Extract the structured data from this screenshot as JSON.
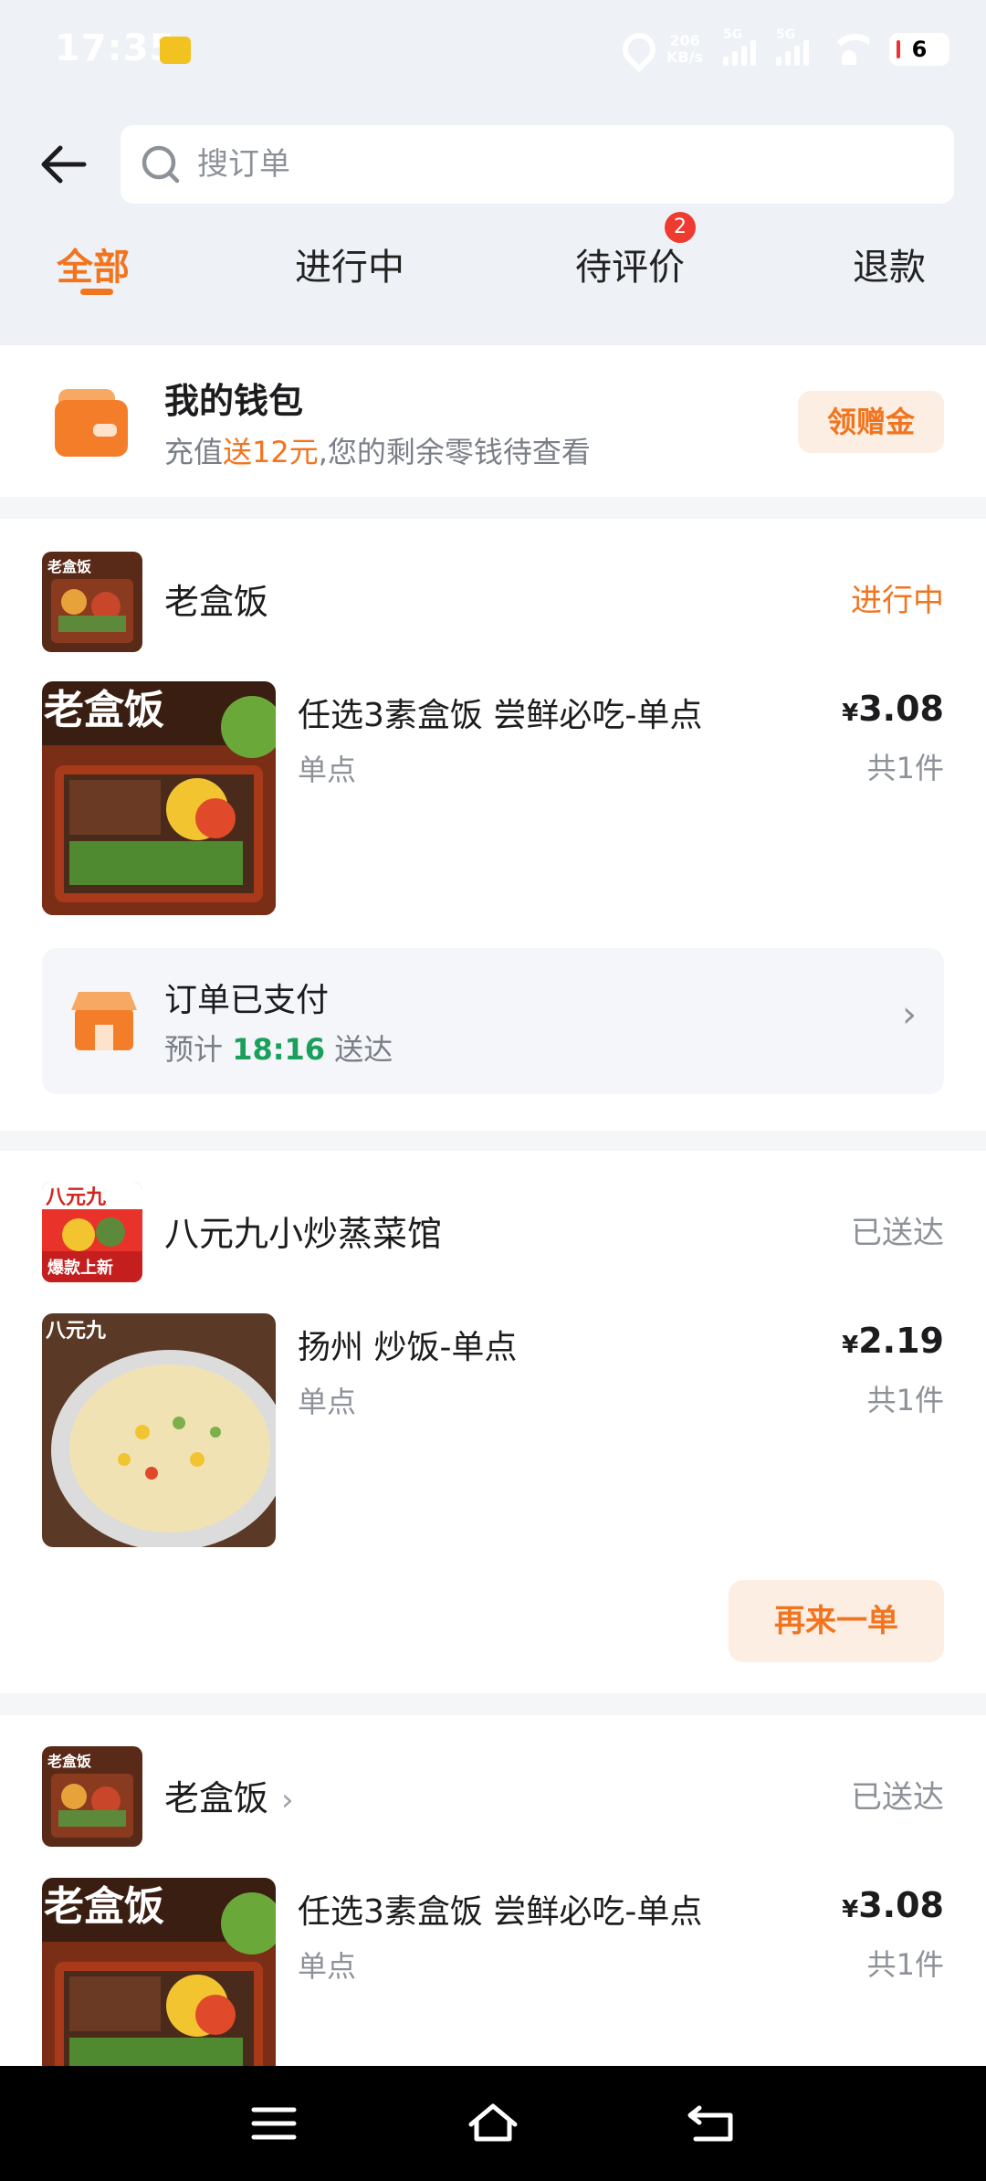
{
  "status_bar": {
    "time": "17:35",
    "speed": "206\nKB/s",
    "signal1": "5G",
    "signal2": "5G",
    "battery": "6"
  },
  "search": {
    "placeholder": "搜订单"
  },
  "tabs": [
    {
      "label": "全部",
      "active": true
    },
    {
      "label": "进行中"
    },
    {
      "label": "待评价",
      "badge": "2"
    },
    {
      "label": "退款"
    }
  ],
  "wallet": {
    "title": "我的钱包",
    "sub_prefix": "充值",
    "sub_highlight": "送12元",
    "sub_suffix": ",您的剩余零钱待查看",
    "button": "领赠金",
    "accent": "#f2741f"
  },
  "orders": [
    {
      "store": "老盒饭",
      "status": "进行中",
      "item_name": "任选3素盒饭 尝鲜必吃-单点",
      "item_sub": "单点",
      "price_symbol": "¥",
      "price": "3.08",
      "qty": "共1件",
      "delivery_title": "订单已支付",
      "delivery_prefix": "预计 ",
      "delivery_time": "18:16",
      "delivery_suffix": " 送达"
    },
    {
      "store": "八元九小炒蒸菜馆",
      "status": "已送达",
      "item_name": "扬州 炒饭-单点",
      "item_sub": "单点",
      "price_symbol": "¥",
      "price": "2.19",
      "qty": "共1件",
      "button": "再来一单"
    },
    {
      "store": "老盒饭",
      "status": "已送达",
      "item_name": "任选3素盒饭 尝鲜必吃-单点",
      "item_sub": "单点",
      "price_symbol": "¥",
      "price": "3.08",
      "qty": "共1件"
    }
  ],
  "image_text": {
    "store1_thumb": "老盒饭",
    "dish1": "老盒饭",
    "store2_thumb_top": "八元九",
    "store2_thumb_bottom": "爆款上新",
    "dish2": "八元九"
  }
}
